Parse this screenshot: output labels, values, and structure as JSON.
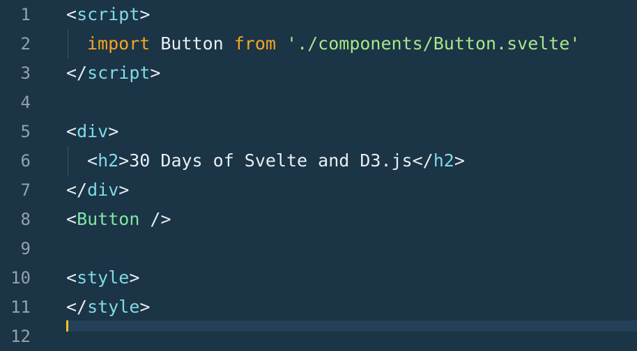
{
  "editor": {
    "line_numbers": [
      "1",
      "2",
      "3",
      "4",
      "5",
      "6",
      "7",
      "8",
      "9",
      "10",
      "11",
      "12"
    ],
    "lines": [
      {
        "open": "<",
        "tag": "script",
        "close": ">"
      },
      {
        "keyword1": "import",
        "ident": " Button ",
        "keyword2": "from",
        "space": " ",
        "string": "'./components/Button.svelte'"
      },
      {
        "open": "</",
        "tag": "script",
        "close": ">"
      },
      {},
      {
        "open": "<",
        "tag": "div",
        "close": ">"
      },
      {
        "open1": "<",
        "tag1": "h2",
        "close1": ">",
        "text": "30 Days of Svelte and D3.js",
        "open2": "</",
        "tag2": "h2",
        "close2": ">"
      },
      {
        "open": "</",
        "tag": "div",
        "close": ">"
      },
      {
        "open": "<",
        "component": "Button",
        "close": " />"
      },
      {},
      {
        "open": "<",
        "tag": "style",
        "close": ">"
      },
      {
        "open": "</",
        "tag": "style",
        "close": ">"
      }
    ]
  },
  "colors": {
    "background": "#1b3446",
    "line_number": "#95a2ad",
    "tag": "#7fdbe6",
    "component": "#7fe8a8",
    "keyword": "#f5a623",
    "string": "#a5e887",
    "cursor": "#f7c520"
  }
}
